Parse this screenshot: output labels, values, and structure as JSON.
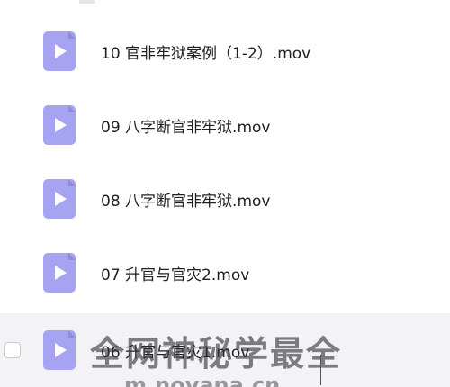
{
  "colors": {
    "icon_bg": "#a6a4f1",
    "icon_play": "#ffffff",
    "hover_row_bg": "#f3f3f5",
    "text": "#1f1f24"
  },
  "files": [
    {
      "name": "10 官非牢狱案例（1-2）.mov",
      "icon": "play-video-icon"
    },
    {
      "name": "09 八字断官非牢狱.mov",
      "icon": "play-video-icon"
    },
    {
      "name": "08 八字断官非牢狱.mov",
      "icon": "play-video-icon"
    },
    {
      "name": "07 升官与官灾2.mov",
      "icon": "play-video-icon"
    },
    {
      "name": "06 升官与官灾1.mov",
      "icon": "play-video-icon"
    }
  ],
  "watermark": {
    "line1": "全网神秘学最全",
    "line2": "m.novana.cn"
  }
}
